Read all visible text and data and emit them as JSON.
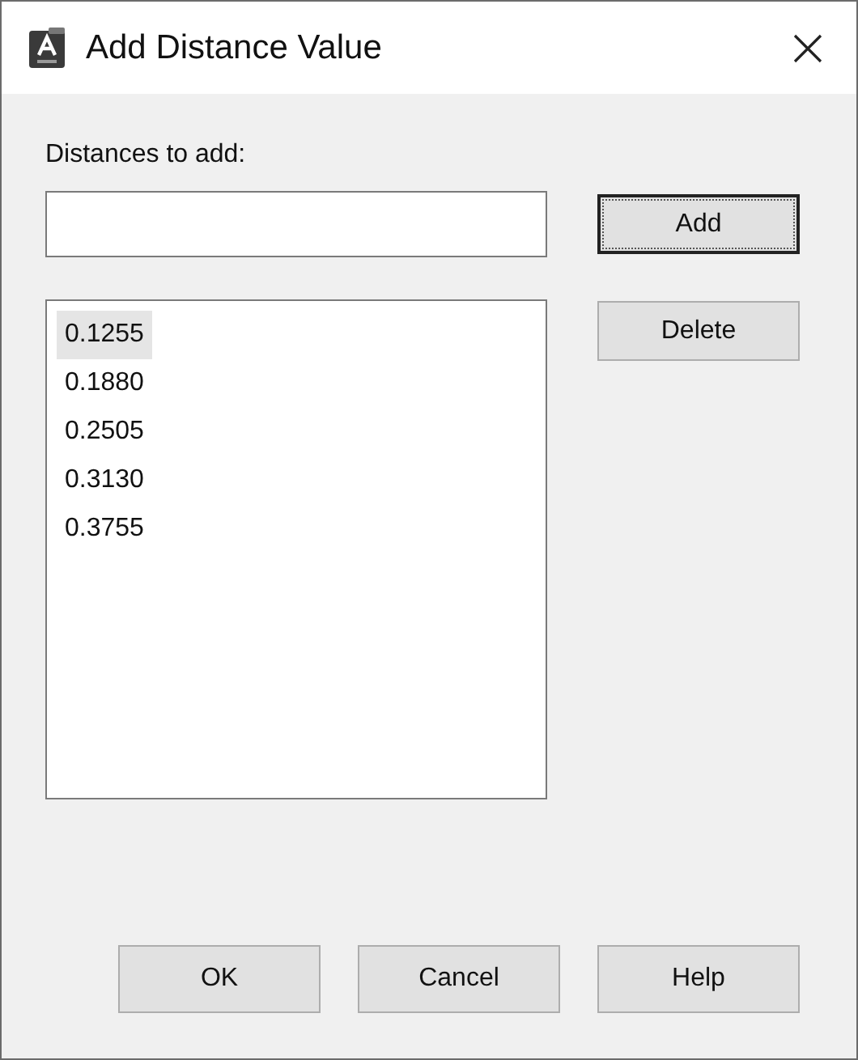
{
  "window": {
    "title": "Add Distance Value"
  },
  "label": "Distances to add:",
  "side_buttons": [
    {
      "label": "Add",
      "default": true
    },
    {
      "label": "Delete",
      "default": false
    }
  ],
  "list": [
    {
      "text": "0.1255",
      "selected": true
    },
    {
      "text": "0.1880",
      "selected": false
    },
    {
      "text": "0.2505",
      "selected": false
    },
    {
      "text": "0.3130",
      "selected": false
    },
    {
      "text": "0.3755",
      "selected": false
    }
  ],
  "buttons": [
    {
      "label": "OK"
    },
    {
      "label": "Cancel"
    },
    {
      "label": "Help"
    }
  ]
}
